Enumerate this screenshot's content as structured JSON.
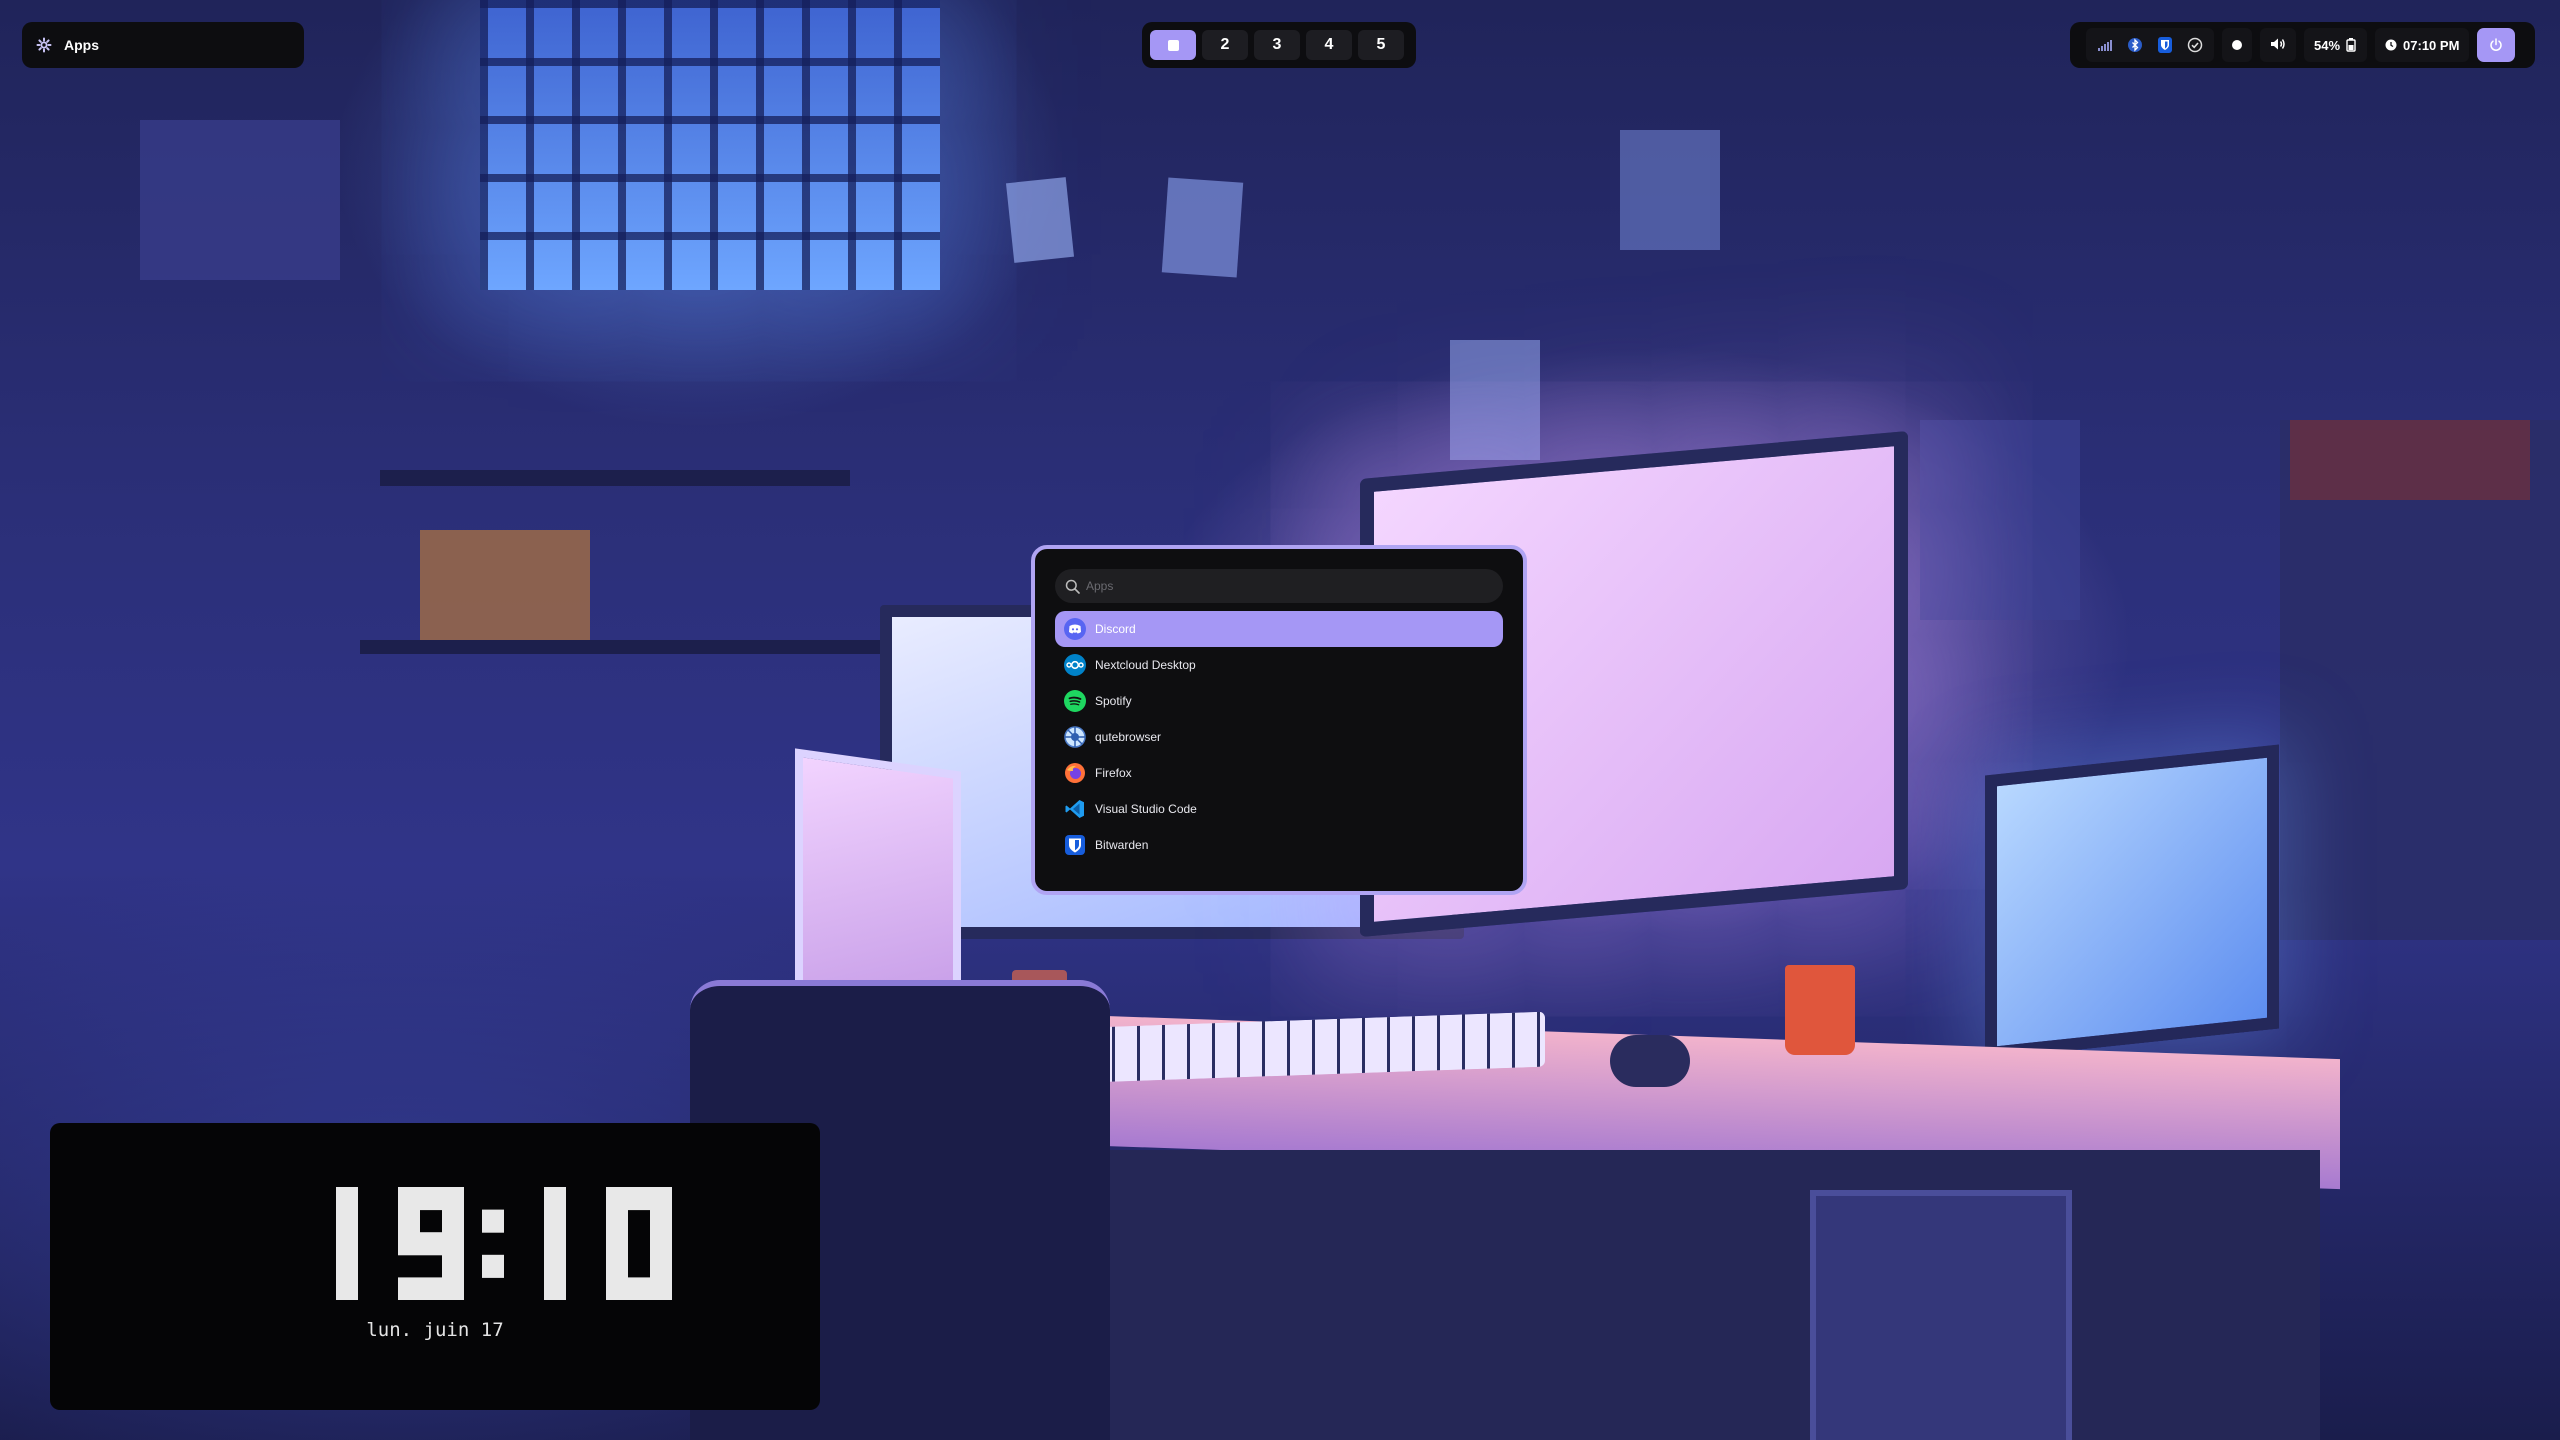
{
  "topbar": {
    "launcher_label": "Apps",
    "workspaces": [
      {
        "label": "",
        "active": true
      },
      {
        "label": "2",
        "active": false
      },
      {
        "label": "3",
        "active": false
      },
      {
        "label": "4",
        "active": false
      },
      {
        "label": "5",
        "active": false
      }
    ],
    "tray_icons": [
      "wifi-icon",
      "bluetooth-icon",
      "bitwarden-tray-icon",
      "checkmark-circle-icon"
    ],
    "record_icon": "record-dot-icon",
    "volume_icon": "volume-icon",
    "battery_text": "54%",
    "time_text": "07:10 PM",
    "accent_color": "#a597f5"
  },
  "launcher": {
    "search_placeholder": "Apps",
    "items": [
      {
        "label": "Discord",
        "icon": "discord-icon",
        "selected": true
      },
      {
        "label": "Nextcloud Desktop",
        "icon": "nextcloud-icon",
        "selected": false
      },
      {
        "label": "Spotify",
        "icon": "spotify-icon",
        "selected": false
      },
      {
        "label": "qutebrowser",
        "icon": "qutebrowser-icon",
        "selected": false
      },
      {
        "label": "Firefox",
        "icon": "firefox-icon",
        "selected": false
      },
      {
        "label": "Visual Studio Code",
        "icon": "vscode-icon",
        "selected": false
      },
      {
        "label": "Bitwarden",
        "icon": "bitwarden-icon",
        "selected": false
      }
    ]
  },
  "clock": {
    "time": "19:10",
    "date": "lun. juin 17"
  }
}
